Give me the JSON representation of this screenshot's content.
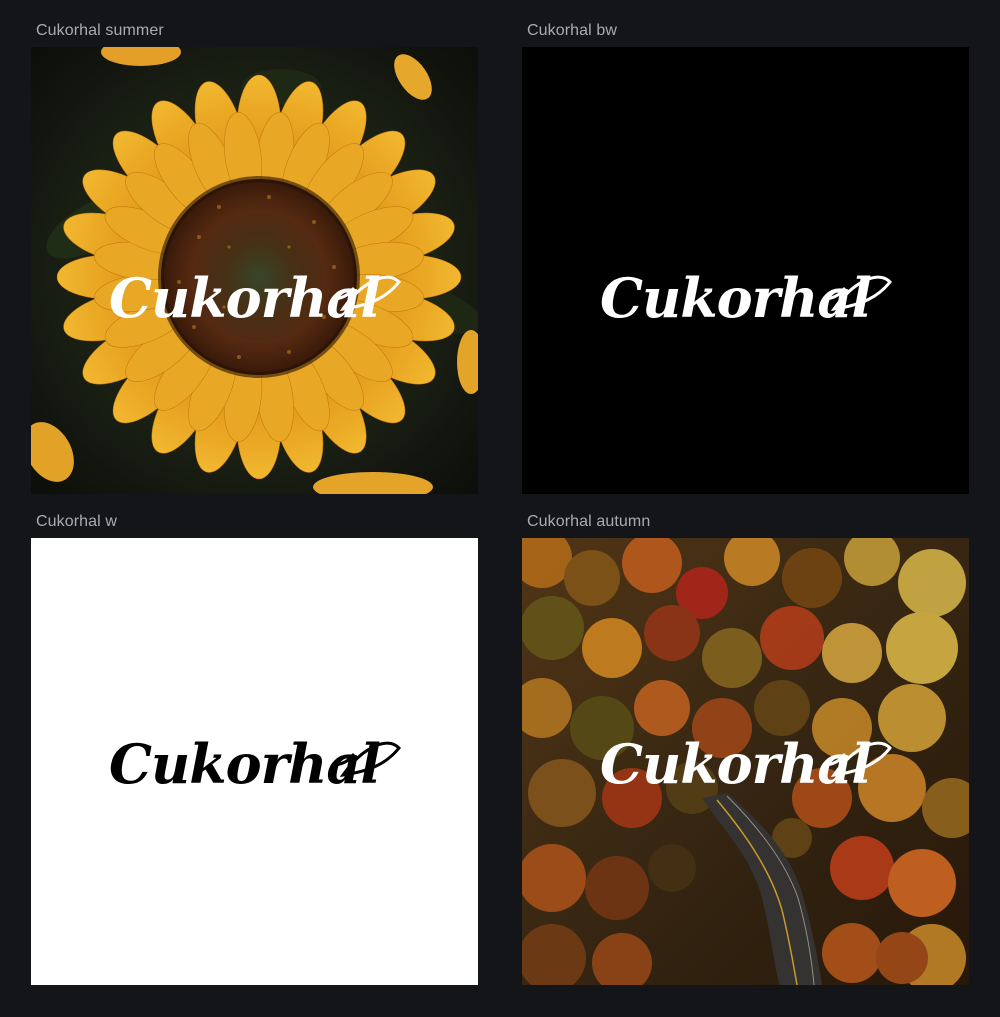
{
  "canvas": {
    "background": "#141518"
  },
  "artboards": [
    {
      "label": "Cukorhal summer",
      "logo_text": "Cukorhal",
      "logo_color": "#ffffff",
      "background": "sunflower-photo",
      "icon": "fish-icon"
    },
    {
      "label": "Cukorhal bw",
      "logo_text": "Cukorhal",
      "logo_color": "#ffffff",
      "background": "#000000",
      "icon": "fish-icon"
    },
    {
      "label": "Cukorhal w",
      "logo_text": "Cukorhal",
      "logo_color": "#000000",
      "background": "#ffffff",
      "icon": "fish-icon"
    },
    {
      "label": "Cukorhal autumn",
      "logo_text": "Cukorhal",
      "logo_color": "#ffffff",
      "background": "autumn-forest-road-photo",
      "icon": "fish-icon"
    }
  ]
}
